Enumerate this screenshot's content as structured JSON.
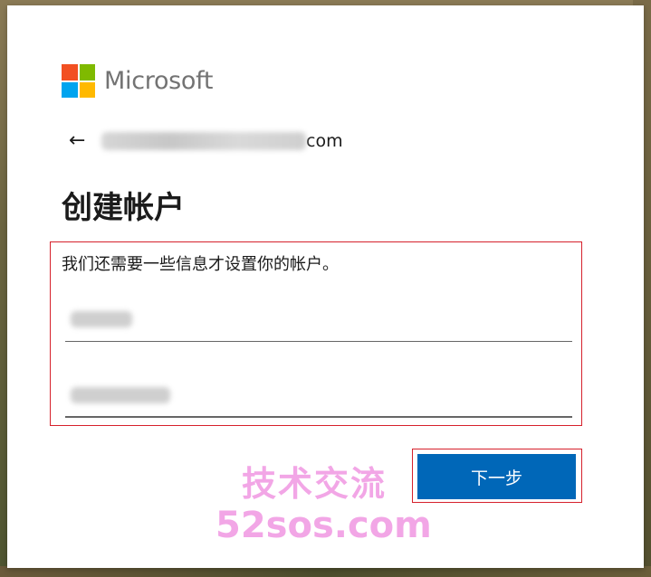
{
  "brand": {
    "name": "Microsoft",
    "logo_colors": [
      "#f25022",
      "#7fba00",
      "#00a4ef",
      "#ffb900"
    ]
  },
  "identity": {
    "back_icon": "←",
    "email_suffix": "com"
  },
  "page": {
    "title": "创建帐户",
    "description": "我们还需要一些信息才设置你的帐户。"
  },
  "actions": {
    "next_label": "下一步"
  },
  "watermark": {
    "line1": "技术交流",
    "line2": "52sos.com"
  },
  "colors": {
    "accent": "#0067b8",
    "highlight": "#d6212c",
    "watermark": "#f2a6e6"
  }
}
